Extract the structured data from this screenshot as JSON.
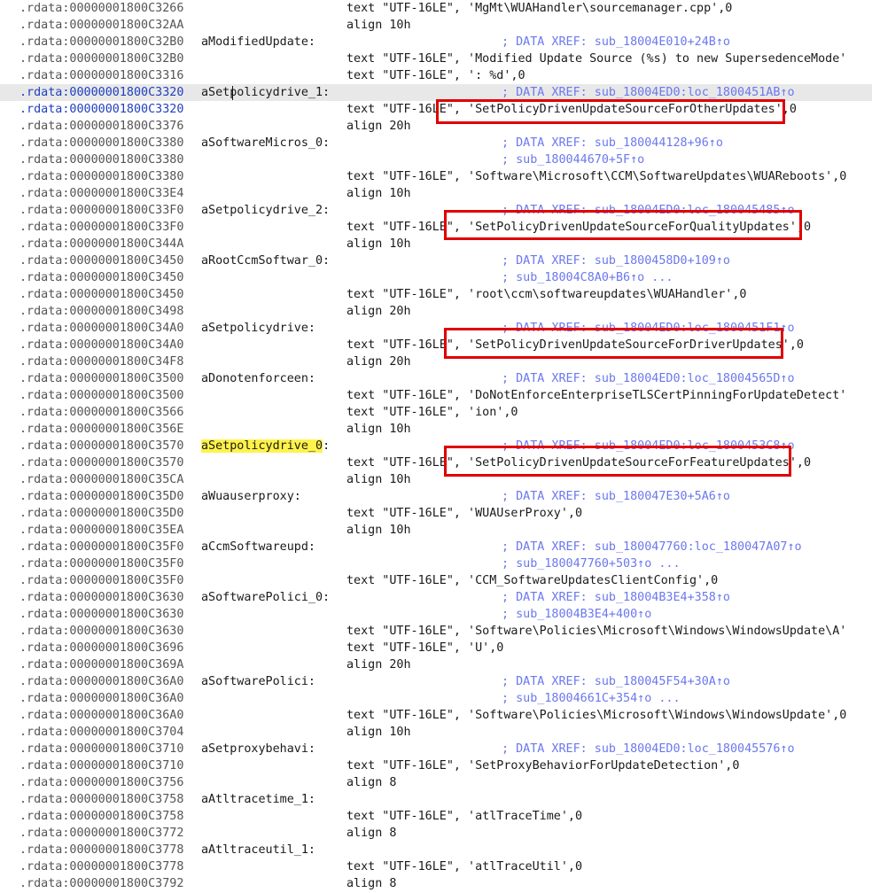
{
  "lines": [
    {
      "addr": ".rdata:00000001800C3266",
      "instr": "text \"UTF-16LE\", 'MgMt\\WUAHandler\\sourcemanager.cpp',0"
    },
    {
      "addr": ".rdata:00000001800C32AA",
      "instr": "align 10h"
    },
    {
      "addr": ".rdata:00000001800C32B0",
      "label": "aModifiedUpdate:",
      "comment": "; DATA XREF: sub_18004E010+24B↑o"
    },
    {
      "addr": ".rdata:00000001800C32B0",
      "instr": "text \"UTF-16LE\", 'Modified Update Source (%s) to new SupersedenceMode'"
    },
    {
      "addr": ".rdata:00000001800C3316",
      "instr": "text \"UTF-16LE\", ': %d',0"
    },
    {
      "addr": ".rdata:00000001800C3320",
      "label": "aSetpolicydrive_1:",
      "comment": "; DATA XREF: sub_18004ED0:loc_1800451AB↑o",
      "current": true
    },
    {
      "addr": ".rdata:00000001800C3320",
      "instr": "text \"UTF-16LE\", 'SetPolicyDrivenUpdateSourceForOtherUpdates',0",
      "current_addr": true
    },
    {
      "addr": ".rdata:00000001800C3376",
      "instr": "align 20h"
    },
    {
      "addr": ".rdata:00000001800C3380",
      "label": "aSoftwareMicros_0:",
      "comment": "; DATA XREF: sub_180044128+96↑o"
    },
    {
      "addr": ".rdata:00000001800C3380",
      "comment": "; sub_180044670+5F↑o"
    },
    {
      "addr": ".rdata:00000001800C3380",
      "instr": "text \"UTF-16LE\", 'Software\\Microsoft\\CCM\\SoftwareUpdates\\WUAReboots',0"
    },
    {
      "addr": ".rdata:00000001800C33E4",
      "instr": "align 10h"
    },
    {
      "addr": ".rdata:00000001800C33F0",
      "label": "aSetpolicydrive_2:",
      "comment": "; DATA XREF: sub_18004ED0:loc_180045485↑o"
    },
    {
      "addr": ".rdata:00000001800C33F0",
      "instr": "text \"UTF-16LE\", 'SetPolicyDrivenUpdateSourceForQualityUpdates',0"
    },
    {
      "addr": ".rdata:00000001800C344A",
      "instr": "align 10h"
    },
    {
      "addr": ".rdata:00000001800C3450",
      "label": "aRootCcmSoftwar_0:",
      "comment": "; DATA XREF: sub_1800458D0+109↑o"
    },
    {
      "addr": ".rdata:00000001800C3450",
      "comment": "; sub_18004C8A0+B6↑o ..."
    },
    {
      "addr": ".rdata:00000001800C3450",
      "instr": "text \"UTF-16LE\", 'root\\ccm\\softwareupdates\\WUAHandler',0"
    },
    {
      "addr": ".rdata:00000001800C3498",
      "instr": "align 20h"
    },
    {
      "addr": ".rdata:00000001800C34A0",
      "label": "aSetpolicydrive:",
      "comment": "; DATA XREF: sub_18004ED0:loc_1800451F1↑o"
    },
    {
      "addr": ".rdata:00000001800C34A0",
      "instr": "text \"UTF-16LE\", 'SetPolicyDrivenUpdateSourceForDriverUpdates',0"
    },
    {
      "addr": ".rdata:00000001800C34F8",
      "instr": "align 20h"
    },
    {
      "addr": ".rdata:00000001800C3500",
      "label": "aDonotenforceen:",
      "comment": "; DATA XREF: sub_18004ED0:loc_18004565D↑o"
    },
    {
      "addr": ".rdata:00000001800C3500",
      "instr": "text \"UTF-16LE\", 'DoNotEnforceEnterpriseTLSCertPinningForUpdateDetect'"
    },
    {
      "addr": ".rdata:00000001800C3566",
      "instr": "text \"UTF-16LE\", 'ion',0"
    },
    {
      "addr": ".rdata:00000001800C356E",
      "instr": "align 10h"
    },
    {
      "addr": ".rdata:00000001800C3570",
      "label": "aSetpolicydrive_0:",
      "comment": "; DATA XREF: sub_18004ED0:loc_1800453C8↑o",
      "highlight": true
    },
    {
      "addr": ".rdata:00000001800C3570",
      "instr": "text \"UTF-16LE\", 'SetPolicyDrivenUpdateSourceForFeatureUpdates',0"
    },
    {
      "addr": ".rdata:00000001800C35CA",
      "instr": "align 10h"
    },
    {
      "addr": ".rdata:00000001800C35D0",
      "label": "aWuauserproxy:",
      "comment": "; DATA XREF: sub_180047E30+5A6↑o"
    },
    {
      "addr": ".rdata:00000001800C35D0",
      "instr": "text \"UTF-16LE\", 'WUAUserProxy',0"
    },
    {
      "addr": ".rdata:00000001800C35EA",
      "instr": "align 10h"
    },
    {
      "addr": ".rdata:00000001800C35F0",
      "label": "aCcmSoftwareupd:",
      "comment": "; DATA XREF: sub_180047760:loc_180047A07↑o"
    },
    {
      "addr": ".rdata:00000001800C35F0",
      "comment": "; sub_180047760+503↑o ..."
    },
    {
      "addr": ".rdata:00000001800C35F0",
      "instr": "text \"UTF-16LE\", 'CCM_SoftwareUpdatesClientConfig',0"
    },
    {
      "addr": ".rdata:00000001800C3630",
      "label": "aSoftwarePolici_0:",
      "comment": "; DATA XREF: sub_18004B3E4+358↑o"
    },
    {
      "addr": ".rdata:00000001800C3630",
      "comment": "; sub_18004B3E4+400↑o"
    },
    {
      "addr": ".rdata:00000001800C3630",
      "instr": "text \"UTF-16LE\", 'Software\\Policies\\Microsoft\\Windows\\WindowsUpdate\\A'"
    },
    {
      "addr": ".rdata:00000001800C3696",
      "instr": "text \"UTF-16LE\", 'U',0"
    },
    {
      "addr": ".rdata:00000001800C369A",
      "instr": "align 20h"
    },
    {
      "addr": ".rdata:00000001800C36A0",
      "label": "aSoftwarePolici:",
      "comment": "; DATA XREF: sub_180045F54+30A↑o"
    },
    {
      "addr": ".rdata:00000001800C36A0",
      "comment": "; sub_18004661C+354↑o ..."
    },
    {
      "addr": ".rdata:00000001800C36A0",
      "instr": "text \"UTF-16LE\", 'Software\\Policies\\Microsoft\\Windows\\WindowsUpdate',0"
    },
    {
      "addr": ".rdata:00000001800C3704",
      "instr": "align 10h"
    },
    {
      "addr": ".rdata:00000001800C3710",
      "label": "aSetproxybehavi:",
      "comment": "; DATA XREF: sub_18004ED0:loc_180045576↑o"
    },
    {
      "addr": ".rdata:00000001800C3710",
      "instr": "text \"UTF-16LE\", 'SetProxyBehaviorForUpdateDetection',0"
    },
    {
      "addr": ".rdata:00000001800C3756",
      "instr": "align 8"
    },
    {
      "addr": ".rdata:00000001800C3758",
      "label": "aAtltracetime_1:"
    },
    {
      "addr": ".rdata:00000001800C3758",
      "instr": "text \"UTF-16LE\", 'atlTraceTime',0"
    },
    {
      "addr": ".rdata:00000001800C3772",
      "instr": "align 8"
    },
    {
      "addr": ".rdata:00000001800C3778",
      "label": "aAtltraceutil_1:"
    },
    {
      "addr": ".rdata:00000001800C3778",
      "instr": "text \"UTF-16LE\", 'atlTraceUtil',0"
    },
    {
      "addr": ".rdata:00000001800C3792",
      "instr": "align 8"
    }
  ],
  "colors": {
    "comment": "#6b78ee",
    "highlight": "#fff24a",
    "current_line": "#e8e8e8",
    "annotation_box": "#e00000"
  }
}
